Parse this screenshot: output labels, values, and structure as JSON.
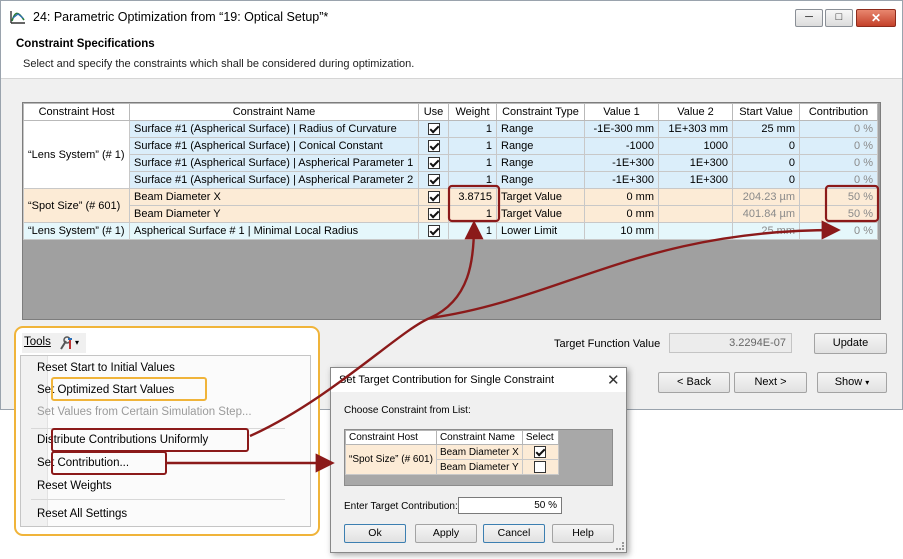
{
  "window": {
    "title": "24: Parametric Optimization from “19: Optical Setup”*",
    "minimize": "─",
    "maximize": "□",
    "close": "✕"
  },
  "header": {
    "title": "Constraint Specifications",
    "description": "Select and specify the constraints which shall be considered during optimization."
  },
  "table": {
    "columns": [
      "Constraint Host",
      "Constraint Name",
      "Use",
      "Weight",
      "Constraint Type",
      "Value 1",
      "Value 2",
      "Start Value",
      "Contribution"
    ],
    "host_groups": [
      "“Lens System” (# 1)",
      "“Spot Size” (# 601)",
      "“Lens System” (# 1)"
    ],
    "rows": [
      {
        "name": "Surface #1 (Aspherical Surface) | Radius of Curvature",
        "use": true,
        "weight": "1",
        "type": "Range",
        "v1": "-1E-300 mm",
        "v2": "1E+303 mm",
        "start": "25 mm",
        "contribution": "0 %"
      },
      {
        "name": "Surface #1 (Aspherical Surface) | Conical Constant",
        "use": true,
        "weight": "1",
        "type": "Range",
        "v1": "-1000",
        "v2": "1000",
        "start": "0",
        "contribution": "0 %"
      },
      {
        "name": "Surface #1 (Aspherical Surface) | Aspherical Parameter 1",
        "use": true,
        "weight": "1",
        "type": "Range",
        "v1": "-1E+300",
        "v2": "1E+300",
        "start": "0",
        "contribution": "0 %"
      },
      {
        "name": "Surface #1 (Aspherical Surface) | Aspherical Parameter 2",
        "use": true,
        "weight": "1",
        "type": "Range",
        "v1": "-1E+300",
        "v2": "1E+300",
        "start": "0",
        "contribution": "0 %"
      },
      {
        "name": "Beam Diameter X",
        "use": true,
        "weight": "3.8715",
        "type": "Target Value",
        "v1": "0 mm",
        "v2": "",
        "start": "204.23 µm",
        "contribution": "50 %"
      },
      {
        "name": "Beam Diameter Y",
        "use": true,
        "weight": "1",
        "type": "Target Value",
        "v1": "0 mm",
        "v2": "",
        "start": "401.84 µm",
        "contribution": "50 %"
      },
      {
        "name": "Aspherical Surface # 1 | Minimal Local Radius",
        "use": true,
        "weight": "1",
        "type": "Lower Limit",
        "v1": "10 mm",
        "v2": "",
        "start": "25 mm",
        "contribution": "0 %"
      }
    ]
  },
  "target_function": {
    "label": "Target Function Value",
    "value": "3.2294E-07"
  },
  "buttons": {
    "update": "Update",
    "back": "< Back",
    "next": "Next >",
    "show": "Show",
    "show_arrow": "▾"
  },
  "tools": {
    "label": "Tools",
    "arrow": "▾",
    "menu": [
      {
        "label": "Reset Start to Initial Values",
        "enabled": true
      },
      {
        "label": "Set Optimized Start Values",
        "enabled": true
      },
      {
        "label": "Set Values from Certain Simulation Step...",
        "enabled": false
      },
      {
        "label": "Distribute Contributions Uniformly",
        "enabled": true
      },
      {
        "label": "Set Contribution...",
        "enabled": true
      },
      {
        "label": "Reset Weights",
        "enabled": true
      },
      {
        "label": "Reset All Settings",
        "enabled": true
      }
    ]
  },
  "dialog": {
    "title": "Set Target Contribution for Single Constraint",
    "close": "✕",
    "choose_label": "Choose Constraint from List:",
    "columns": [
      "Constraint Host",
      "Constraint Name",
      "Select"
    ],
    "host": "“Spot Size” (# 601)",
    "rows": [
      {
        "name": "Beam Diameter X",
        "selected": true
      },
      {
        "name": "Beam Diameter Y",
        "selected": false
      }
    ],
    "target_label": "Enter Target Contribution:",
    "target_value": "50 %",
    "ok": "Ok",
    "apply": "Apply",
    "cancel": "Cancel",
    "help": "Help"
  },
  "colors": {
    "highlight_orange": "#f0b43a",
    "highlight_red": "#8b1a1a",
    "row_blue": "#dbeefa",
    "row_peach": "#fcebd6",
    "row_cyan": "#e5f7fb"
  }
}
